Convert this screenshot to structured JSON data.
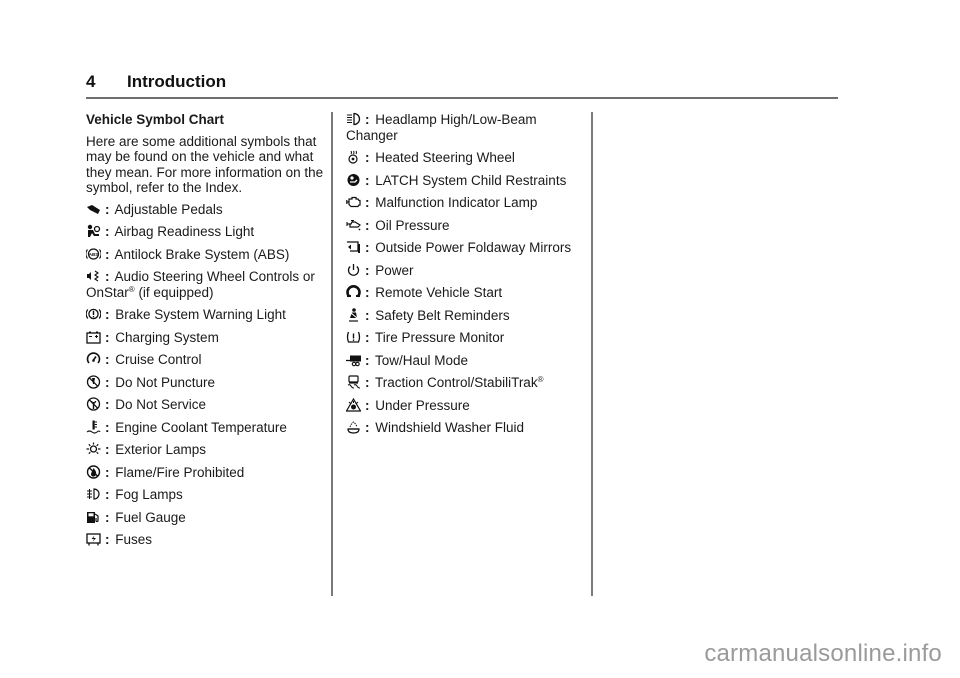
{
  "header": {
    "page_number": "4",
    "chapter_title": "Introduction"
  },
  "section": {
    "title": "Vehicle Symbol Chart",
    "intro": "Here are some additional symbols that may be found on the vehicle and what they mean. For more information on the symbol, refer to the Index."
  },
  "left_column": [
    {
      "icon": "adjustable-pedals-icon",
      "label": "Adjustable Pedals"
    },
    {
      "icon": "airbag-readiness-icon",
      "label": "Airbag Readiness Light"
    },
    {
      "icon": "abs-icon",
      "label": "Antilock Brake System (ABS)"
    },
    {
      "icon": "audio-steering-wheel-icon",
      "label": "Audio Steering Wheel Controls or OnStar",
      "sup": "®",
      "suffix": " (if equipped)"
    },
    {
      "icon": "brake-warning-icon",
      "label": "Brake System Warning Light"
    },
    {
      "icon": "battery-icon",
      "label": "Charging System"
    },
    {
      "icon": "cruise-control-icon",
      "label": "Cruise Control"
    },
    {
      "icon": "do-not-puncture-icon",
      "label": "Do Not Puncture"
    },
    {
      "icon": "do-not-service-icon",
      "label": "Do Not Service"
    },
    {
      "icon": "coolant-temperature-icon",
      "label": "Engine Coolant Temperature"
    },
    {
      "icon": "exterior-lamps-icon",
      "label": "Exterior Lamps"
    },
    {
      "icon": "flame-prohibited-icon",
      "label": "Flame/Fire Prohibited"
    },
    {
      "icon": "fog-lamps-icon",
      "label": "Fog Lamps"
    },
    {
      "icon": "fuel-gauge-icon",
      "label": "Fuel Gauge"
    },
    {
      "icon": "fuses-icon",
      "label": "Fuses"
    }
  ],
  "middle_column": [
    {
      "icon": "headlamp-beam-icon",
      "label": "Headlamp High/Low-Beam Changer"
    },
    {
      "icon": "heated-steering-wheel-icon",
      "label": "Heated Steering Wheel"
    },
    {
      "icon": "latch-child-restraint-icon",
      "label": "LATCH System Child Restraints"
    },
    {
      "icon": "check-engine-icon",
      "label": "Malfunction Indicator Lamp"
    },
    {
      "icon": "oil-pressure-icon",
      "label": "Oil Pressure"
    },
    {
      "icon": "folding-mirror-icon",
      "label": "Outside Power Foldaway Mirrors"
    },
    {
      "icon": "power-icon",
      "label": "Power"
    },
    {
      "icon": "remote-start-icon",
      "label": "Remote Vehicle Start"
    },
    {
      "icon": "seat-belt-icon",
      "label": "Safety Belt Reminders"
    },
    {
      "icon": "tire-pressure-icon",
      "label": "Tire Pressure Monitor"
    },
    {
      "icon": "tow-haul-icon",
      "label": "Tow/Haul Mode"
    },
    {
      "icon": "traction-control-icon",
      "label": "Traction Control/StabiliTrak",
      "sup": "®"
    },
    {
      "icon": "under-pressure-icon",
      "label": "Under Pressure"
    },
    {
      "icon": "washer-fluid-icon",
      "label": "Windshield Washer Fluid"
    }
  ],
  "separator": ":",
  "watermark": "carmanualsonline.info"
}
